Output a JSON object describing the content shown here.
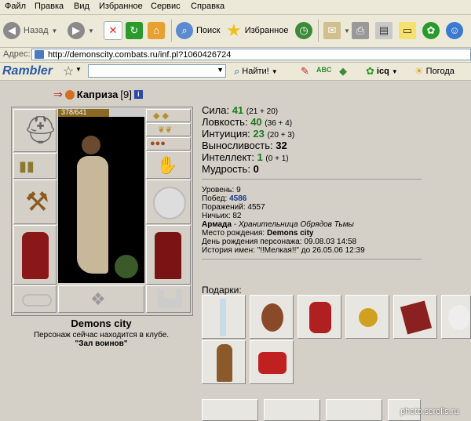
{
  "menu": [
    "Файл",
    "Правка",
    "Вид",
    "Избранное",
    "Сервис",
    "Справка"
  ],
  "toolbar": {
    "back": "Назад",
    "search": "Поиск",
    "favorites": "Избранное"
  },
  "address": {
    "label": "Адрес:",
    "url": "http://demonscity.combats.ru/inf.pl?1060426724"
  },
  "rambler": {
    "logo": "Rambler",
    "find": "Найти!",
    "icq": "icq",
    "weather": "Погода"
  },
  "character": {
    "name": "Каприза",
    "level": "[9]",
    "hp": "378/641"
  },
  "stats": [
    {
      "name": "Сила:",
      "value": "41",
      "detail": "(21 + 20)"
    },
    {
      "name": "Ловкость:",
      "value": "40",
      "detail": "(36 + 4)"
    },
    {
      "name": "Интуиция:",
      "value": "23",
      "detail": "(20 + 3)"
    },
    {
      "name": "Выносливость:",
      "value": "32",
      "detail": ""
    },
    {
      "name": "Интеллект:",
      "value": "1",
      "detail": "(0 + 1)"
    },
    {
      "name": "Мудрость:",
      "value": "0",
      "detail": ""
    }
  ],
  "info": {
    "level_label": "Уровень:",
    "level": "9",
    "wins_label": "Побед:",
    "wins": "4586",
    "losses_label": "Поражений:",
    "losses": "4557",
    "draws_label": "Ничьих:",
    "draws": "82",
    "armada_label": "Армада",
    "armada_value": "- Хранительница Обрядов Тьмы",
    "birthplace_label": "Место рождения:",
    "birthplace": "Demons city",
    "birthday": "День рождения персонажа: 09.08.03 14:58",
    "history": "История имен: \"!!Мелкая!!\" до 26.05.06 12:39"
  },
  "location": {
    "city": "Demons city",
    "status": "Персонаж сейчас находится в клубе.",
    "room": "\"Зал воинов\""
  },
  "gifts_label": "Подарки:",
  "watermark": "photo.scrolls.ru"
}
